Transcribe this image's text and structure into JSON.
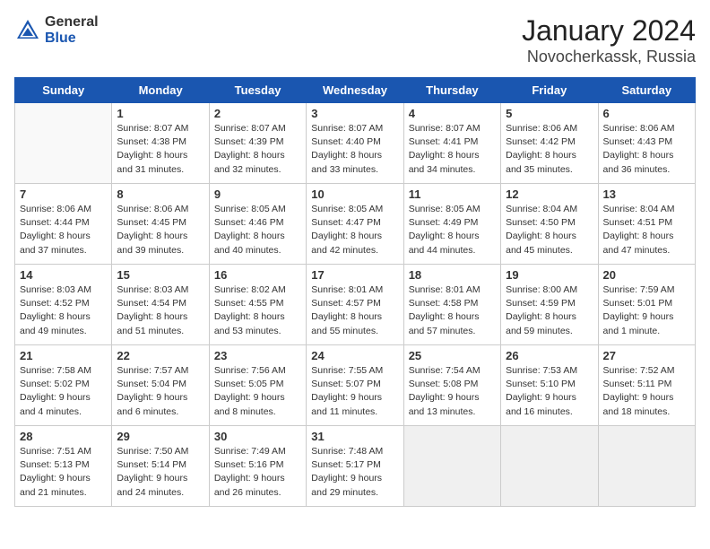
{
  "logo": {
    "general": "General",
    "blue": "Blue"
  },
  "header": {
    "month": "January 2024",
    "location": "Novocherkassk, Russia"
  },
  "weekdays": [
    "Sunday",
    "Monday",
    "Tuesday",
    "Wednesday",
    "Thursday",
    "Friday",
    "Saturday"
  ],
  "weeks": [
    [
      {
        "day": "",
        "empty": true
      },
      {
        "day": "1",
        "sunrise": "8:07 AM",
        "sunset": "4:38 PM",
        "daylight": "8 hours and 31 minutes."
      },
      {
        "day": "2",
        "sunrise": "8:07 AM",
        "sunset": "4:39 PM",
        "daylight": "8 hours and 32 minutes."
      },
      {
        "day": "3",
        "sunrise": "8:07 AM",
        "sunset": "4:40 PM",
        "daylight": "8 hours and 33 minutes."
      },
      {
        "day": "4",
        "sunrise": "8:07 AM",
        "sunset": "4:41 PM",
        "daylight": "8 hours and 34 minutes."
      },
      {
        "day": "5",
        "sunrise": "8:06 AM",
        "sunset": "4:42 PM",
        "daylight": "8 hours and 35 minutes."
      },
      {
        "day": "6",
        "sunrise": "8:06 AM",
        "sunset": "4:43 PM",
        "daylight": "8 hours and 36 minutes."
      }
    ],
    [
      {
        "day": "7",
        "sunrise": "8:06 AM",
        "sunset": "4:44 PM",
        "daylight": "8 hours and 37 minutes."
      },
      {
        "day": "8",
        "sunrise": "8:06 AM",
        "sunset": "4:45 PM",
        "daylight": "8 hours and 39 minutes."
      },
      {
        "day": "9",
        "sunrise": "8:05 AM",
        "sunset": "4:46 PM",
        "daylight": "8 hours and 40 minutes."
      },
      {
        "day": "10",
        "sunrise": "8:05 AM",
        "sunset": "4:47 PM",
        "daylight": "8 hours and 42 minutes."
      },
      {
        "day": "11",
        "sunrise": "8:05 AM",
        "sunset": "4:49 PM",
        "daylight": "8 hours and 44 minutes."
      },
      {
        "day": "12",
        "sunrise": "8:04 AM",
        "sunset": "4:50 PM",
        "daylight": "8 hours and 45 minutes."
      },
      {
        "day": "13",
        "sunrise": "8:04 AM",
        "sunset": "4:51 PM",
        "daylight": "8 hours and 47 minutes."
      }
    ],
    [
      {
        "day": "14",
        "sunrise": "8:03 AM",
        "sunset": "4:52 PM",
        "daylight": "8 hours and 49 minutes."
      },
      {
        "day": "15",
        "sunrise": "8:03 AM",
        "sunset": "4:54 PM",
        "daylight": "8 hours and 51 minutes."
      },
      {
        "day": "16",
        "sunrise": "8:02 AM",
        "sunset": "4:55 PM",
        "daylight": "8 hours and 53 minutes."
      },
      {
        "day": "17",
        "sunrise": "8:01 AM",
        "sunset": "4:57 PM",
        "daylight": "8 hours and 55 minutes."
      },
      {
        "day": "18",
        "sunrise": "8:01 AM",
        "sunset": "4:58 PM",
        "daylight": "8 hours and 57 minutes."
      },
      {
        "day": "19",
        "sunrise": "8:00 AM",
        "sunset": "4:59 PM",
        "daylight": "8 hours and 59 minutes."
      },
      {
        "day": "20",
        "sunrise": "7:59 AM",
        "sunset": "5:01 PM",
        "daylight": "9 hours and 1 minute."
      }
    ],
    [
      {
        "day": "21",
        "sunrise": "7:58 AM",
        "sunset": "5:02 PM",
        "daylight": "9 hours and 4 minutes."
      },
      {
        "day": "22",
        "sunrise": "7:57 AM",
        "sunset": "5:04 PM",
        "daylight": "9 hours and 6 minutes."
      },
      {
        "day": "23",
        "sunrise": "7:56 AM",
        "sunset": "5:05 PM",
        "daylight": "9 hours and 8 minutes."
      },
      {
        "day": "24",
        "sunrise": "7:55 AM",
        "sunset": "5:07 PM",
        "daylight": "9 hours and 11 minutes."
      },
      {
        "day": "25",
        "sunrise": "7:54 AM",
        "sunset": "5:08 PM",
        "daylight": "9 hours and 13 minutes."
      },
      {
        "day": "26",
        "sunrise": "7:53 AM",
        "sunset": "5:10 PM",
        "daylight": "9 hours and 16 minutes."
      },
      {
        "day": "27",
        "sunrise": "7:52 AM",
        "sunset": "5:11 PM",
        "daylight": "9 hours and 18 minutes."
      }
    ],
    [
      {
        "day": "28",
        "sunrise": "7:51 AM",
        "sunset": "5:13 PM",
        "daylight": "9 hours and 21 minutes."
      },
      {
        "day": "29",
        "sunrise": "7:50 AM",
        "sunset": "5:14 PM",
        "daylight": "9 hours and 24 minutes."
      },
      {
        "day": "30",
        "sunrise": "7:49 AM",
        "sunset": "5:16 PM",
        "daylight": "9 hours and 26 minutes."
      },
      {
        "day": "31",
        "sunrise": "7:48 AM",
        "sunset": "5:17 PM",
        "daylight": "9 hours and 29 minutes."
      },
      {
        "day": "",
        "empty": true
      },
      {
        "day": "",
        "empty": true
      },
      {
        "day": "",
        "empty": true
      }
    ]
  ]
}
